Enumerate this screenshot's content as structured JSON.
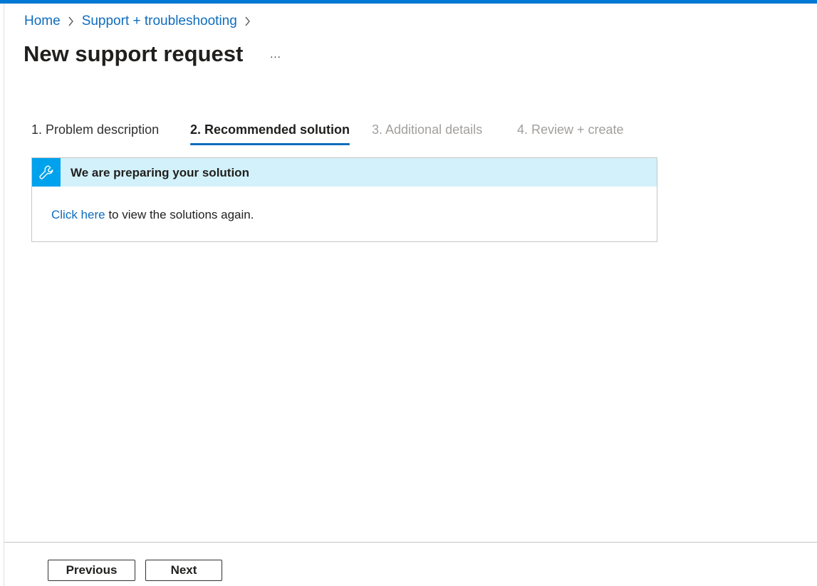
{
  "breadcrumb": {
    "items": [
      "Home",
      "Support + troubleshooting"
    ]
  },
  "header": {
    "title": "New support request",
    "more_label": "..."
  },
  "tabs": [
    {
      "label": "1. Problem description",
      "state": "completed"
    },
    {
      "label": "2. Recommended solution",
      "state": "active"
    },
    {
      "label": "3. Additional details",
      "state": "disabled"
    },
    {
      "label": "4. Review + create",
      "state": "disabled"
    }
  ],
  "info_banner": {
    "icon": "wrench-icon",
    "title": "We are preparing your solution",
    "link_text": "Click here",
    "body_text": " to view the solutions again."
  },
  "footer": {
    "previous_label": "Previous",
    "next_label": "Next"
  },
  "colors": {
    "accent": "#0078d4",
    "link": "#0f6cbd",
    "info_header_bg": "#d3f1fa",
    "info_icon_bg": "#00a2ed",
    "disabled_text": "#a19f9d"
  }
}
